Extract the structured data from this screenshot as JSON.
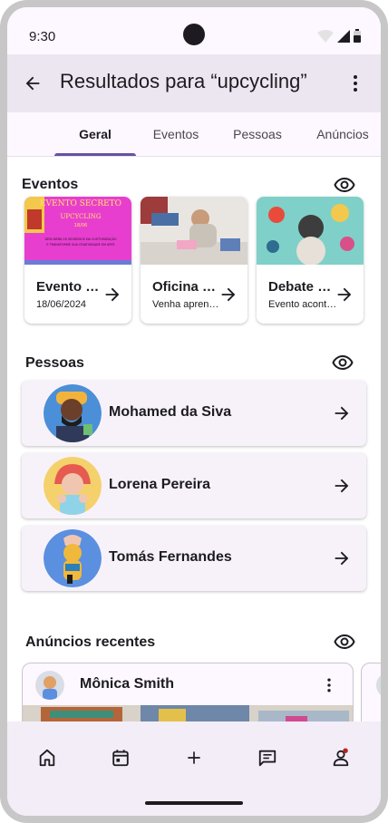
{
  "status_bar": {
    "time": "9:30"
  },
  "app_bar": {
    "title": "Resultados para “upcycling”"
  },
  "tabs": [
    {
      "label": "Geral",
      "active": true
    },
    {
      "label": "Eventos",
      "active": false
    },
    {
      "label": "Pessoas",
      "active": false
    },
    {
      "label": "Anúncios",
      "active": false
    }
  ],
  "events_section": {
    "title": "Eventos",
    "items": [
      {
        "name": "Evento Secreto",
        "subtitle": "18/06/2024",
        "poster": {
          "heading": "EVENTO SECRETO",
          "subheading": "UPCYCLING",
          "date": "18/06",
          "line1": "DESCUBRA OS SEGREDOS DA CUSTOMIZAÇÃO",
          "line2": "E TRANSFORME SUA CRIATIVIDADE EM ARTE"
        }
      },
      {
        "name": "Oficina de upcycling",
        "subtitle": "Venha aprender"
      },
      {
        "name": "Debate sobre moda",
        "subtitle": "Evento acontecendo"
      }
    ]
  },
  "people_section": {
    "title": "Pessoas",
    "items": [
      {
        "name": "Mohamed da Siva"
      },
      {
        "name": "Lorena Pereira"
      },
      {
        "name": "Tomás Fernandes"
      }
    ]
  },
  "ads_section": {
    "title": "Anúncios recentes",
    "items": [
      {
        "author": "Mônica Smith"
      }
    ]
  },
  "icons": [
    "arrow-back-icon",
    "more-vert-icon",
    "eye-icon",
    "arrow-forward-icon",
    "home-icon",
    "calendar-icon",
    "add-icon",
    "chat-icon",
    "person-icon"
  ],
  "colors": {
    "primary": "#6750a4",
    "surface": "#fdf7ff",
    "app_bar": "#ece6f0",
    "nav_bar": "#f3edf7",
    "notification_dot": "#b3261e"
  }
}
